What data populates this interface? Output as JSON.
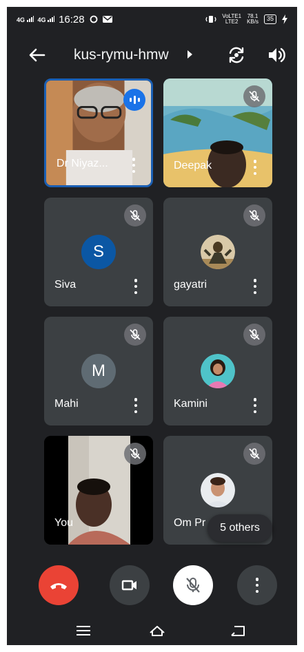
{
  "status_bar": {
    "net1": "4G",
    "net2": "4G",
    "time": "16:28",
    "volte_top": "VoLTE1",
    "volte_bottom": "LTE2",
    "speed_value": "78.1",
    "speed_unit": "KB/s",
    "battery": "35"
  },
  "header": {
    "meeting_code": "kus-rymu-hmw"
  },
  "participants": [
    {
      "name": "Dr Niyaz...",
      "muted": false,
      "speaking": true
    },
    {
      "name": "Deepak",
      "muted": true,
      "speaking": false
    },
    {
      "name": "Siva",
      "initial": "S",
      "avatar_color": "#0b57a4",
      "muted": true
    },
    {
      "name": "gayatri",
      "muted": true
    },
    {
      "name": "Mahi",
      "initial": "M",
      "avatar_color": "#5f6b73",
      "muted": true
    },
    {
      "name": "Kamini",
      "muted": true
    },
    {
      "name": "You",
      "muted": true
    },
    {
      "name": "Om Pr",
      "muted": true
    }
  ],
  "others_badge": "5 others",
  "controls": {
    "end_call_color": "#ea4335",
    "mic_muted": true
  }
}
